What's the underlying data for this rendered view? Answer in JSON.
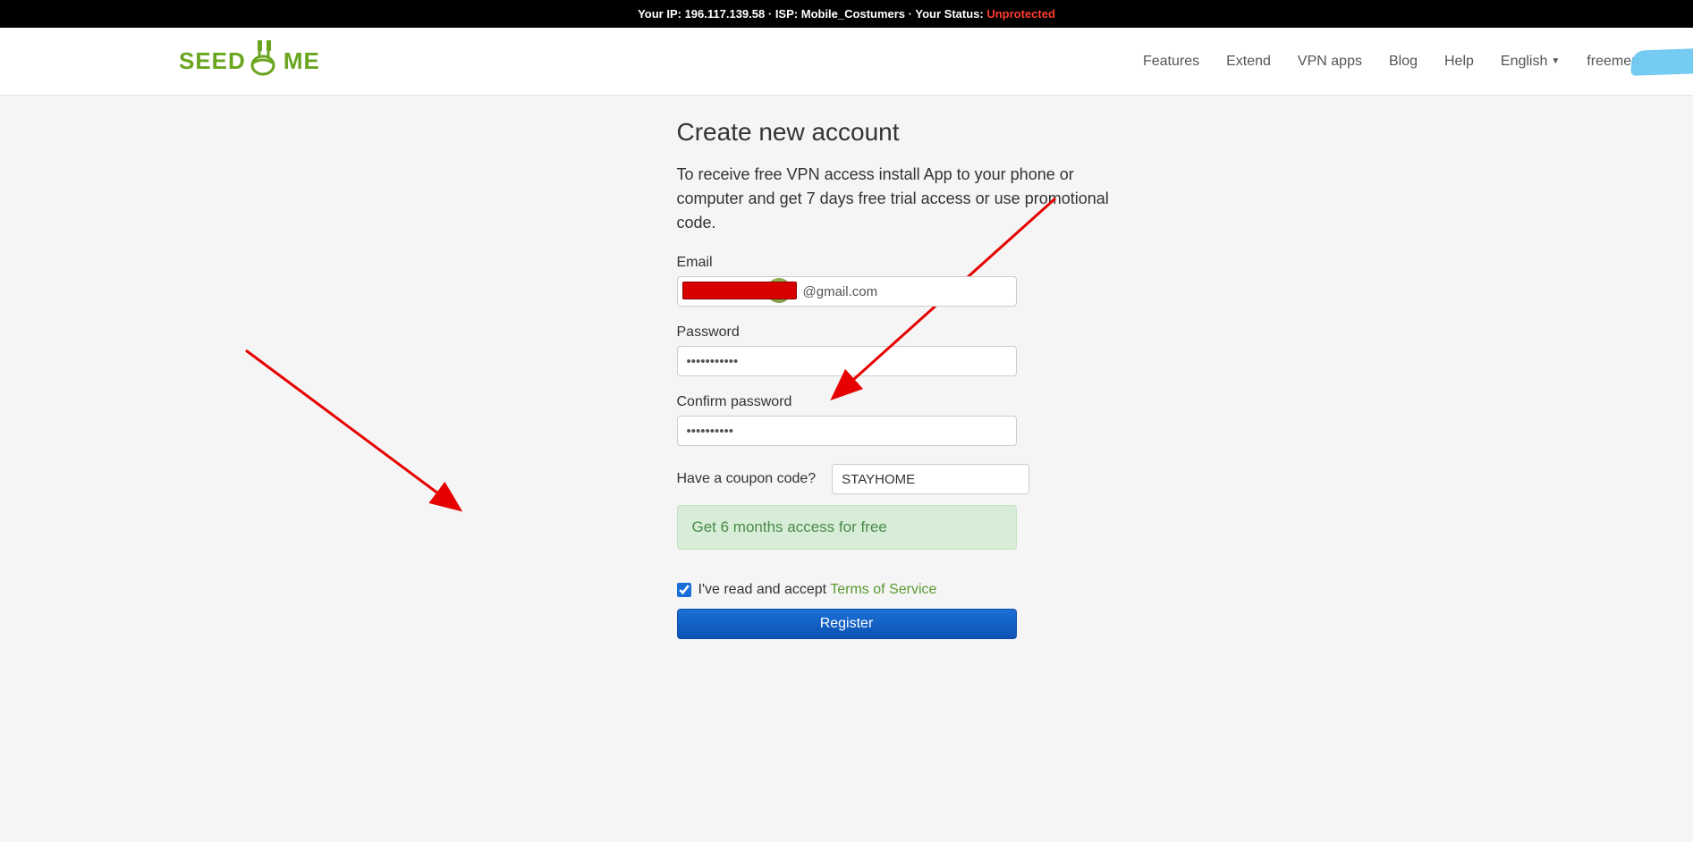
{
  "topbar": {
    "ip_label": "Your IP:",
    "ip_value": "196.117.139.58",
    "sep": " · ",
    "isp_label": "ISP:",
    "isp_value": "Mobile_Costumers",
    "status_label": "Your Status:",
    "status_value": "Unprotected"
  },
  "logo": {
    "part1": "SEED",
    "part2": "ME"
  },
  "nav": {
    "features": "Features",
    "extend": "Extend",
    "vpn_apps": "VPN apps",
    "blog": "Blog",
    "help": "Help",
    "language": "English",
    "user_prefix": "freemen"
  },
  "page": {
    "title": "Create new account",
    "subtitle": "To receive free VPN access install App to your phone or computer and get 7 days free trial access or use promotional code."
  },
  "form": {
    "email_label": "Email",
    "email_value": "@gmail.com",
    "password_label": "Password",
    "password_value": "•••••••••••",
    "confirm_label": "Confirm password",
    "confirm_value": "••••••••••",
    "coupon_label": "Have a coupon code?",
    "coupon_value": "STAYHOME",
    "promo_banner": "Get 6 months access for free",
    "tos_prefix": "I've read and accept ",
    "tos_link": "Terms of Service",
    "register_btn": "Register"
  }
}
